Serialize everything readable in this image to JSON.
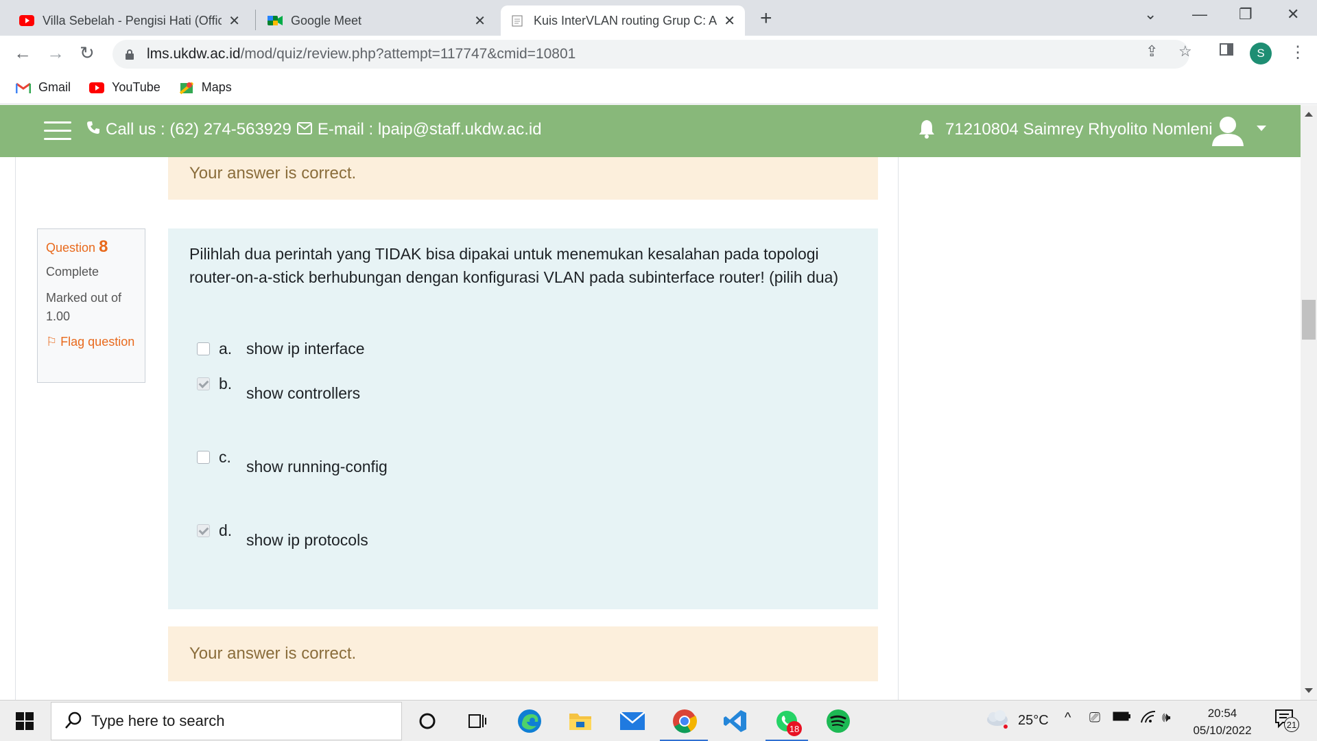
{
  "browser": {
    "tabs": [
      {
        "title": "Villa Sebelah - Pengisi Hati (Official",
        "icon": "youtube-icon"
      },
      {
        "title": "Google Meet",
        "icon": "google-meet-icon"
      },
      {
        "title": "Kuis InterVLAN routing Grup C: A",
        "icon": "moodle-quiz-icon",
        "active": true
      }
    ],
    "url_host": "lms.ukdw.ac.id",
    "url_path": "/mod/quiz/review.php?attempt=117747&cmid=10801",
    "profile_initial": "S",
    "bookmarks": [
      {
        "label": "Gmail",
        "icon": "gmail-icon"
      },
      {
        "label": "YouTube",
        "icon": "youtube-icon"
      },
      {
        "label": "Maps",
        "icon": "maps-icon"
      }
    ]
  },
  "site_header": {
    "contact_call": "Call us : (62) 274-563929",
    "contact_email": "E-mail : lpaip@staff.ukdw.ac.id",
    "user_name": "71210804 Saimrey Rhyolito Nomleni",
    "accent_color": "#88b87a"
  },
  "feedback_top": "Your answer is correct.",
  "question": {
    "label": "Question",
    "number": "8",
    "state": "Complete",
    "grade": "Marked out of 1.00",
    "flag_label": "Flag question",
    "text": "Pilihlah dua perintah yang TIDAK bisa dipakai untuk menemukan kesalahan pada topologi router-on-a-stick berhubungan dengan konfigurasi VLAN pada subinterface router! (pilih dua)",
    "options": [
      {
        "letter": "a.",
        "text": "show ip interface",
        "checked": false
      },
      {
        "letter": "b.",
        "text": "show controllers",
        "checked": true
      },
      {
        "letter": "c.",
        "text": "show running-config",
        "checked": false
      },
      {
        "letter": "d.",
        "text": "show ip protocols",
        "checked": true
      }
    ]
  },
  "feedback_bottom": "Your answer is correct.",
  "taskbar": {
    "search_placeholder": "Type here to search",
    "whatsapp_badge": "18",
    "temperature": "25°C",
    "time": "20:54",
    "date": "05/10/2022",
    "notification_count": "21"
  }
}
